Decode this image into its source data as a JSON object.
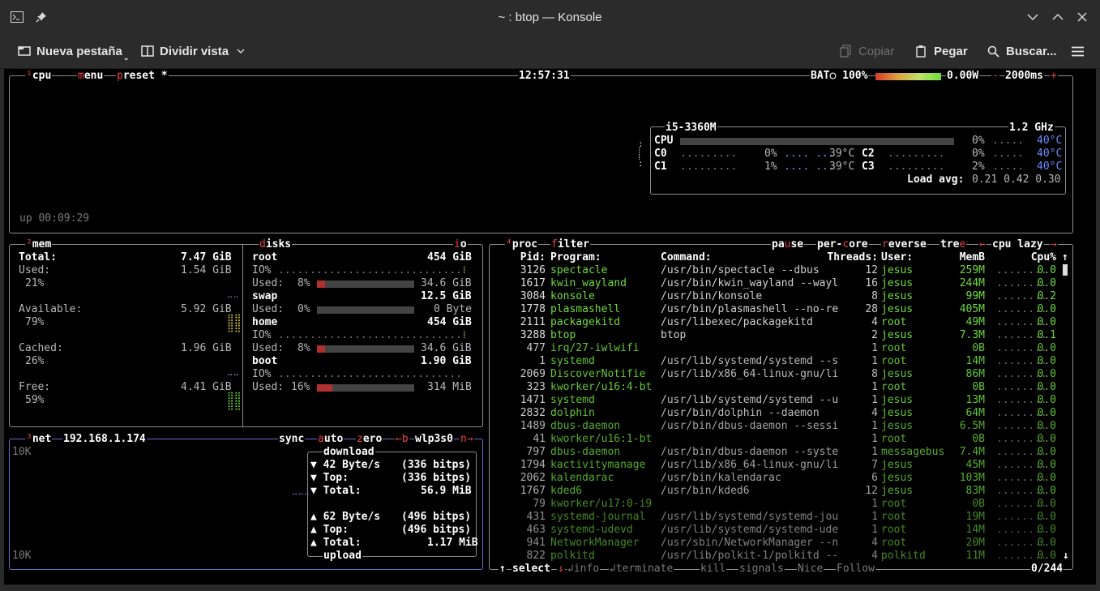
{
  "window": {
    "title": "~ : btop — Konsole",
    "new_tab": "Nueva pestaña",
    "split_view": "Dividir vista",
    "copy": "Copiar",
    "paste": "Pegar",
    "search": "Buscar..."
  },
  "cpu": {
    "label": "cpu",
    "hotkey": "¹",
    "menu": "menu",
    "preset": "preset *",
    "clock": "12:57:31",
    "battery": "BAT○ 100%",
    "power": "0.00W",
    "interval": "2000ms",
    "minus": "-",
    "plus": "+",
    "uptime": "up 00:09:29",
    "model": "i5-3360M",
    "freq": "1.2 GHz",
    "total_label": "CPU",
    "total_pct": "0%",
    "total_temp": "40°C",
    "cores": [
      {
        "name": "C0",
        "pct": "0%",
        "temp": "39°C",
        "value": 0
      },
      {
        "name": "C1",
        "pct": "1%",
        "temp": "39°C",
        "value": 1
      },
      {
        "name": "C2",
        "pct": "0%",
        "temp": "40°C",
        "value": 0
      },
      {
        "name": "C3",
        "pct": "2%",
        "temp": "40°C",
        "value": 2
      }
    ],
    "load_label": "Load avg:",
    "load": "0.21 0.42 0.30"
  },
  "mem": {
    "label": "mem",
    "hotkey": "²",
    "total_label": "Total:",
    "total": "7.47 GiB",
    "used_label": "Used:",
    "used": "1.54 GiB",
    "used_pct": "21%",
    "avail_label": "Available:",
    "avail": "5.92 GiB",
    "avail_pct": "79%",
    "cached_label": "Cached:",
    "cached": "1.96 GiB",
    "cached_pct": "26%",
    "free_label": "Free:",
    "free": "4.41 GiB",
    "free_pct": "59%"
  },
  "disks": {
    "label": "disks",
    "io": "io",
    "items": [
      {
        "name": "root",
        "size": "454 GiB",
        "io": "IO%",
        "used_label": "Used:",
        "pct": "8%",
        "used": "34.6 GiB",
        "value": 8
      },
      {
        "name": "swap",
        "size": "12.5 GiB",
        "io": "",
        "used_label": "Used:",
        "pct": "0%",
        "used": "0 Byte",
        "value": 0
      },
      {
        "name": "home",
        "size": "454 GiB",
        "io": "IO%",
        "used_label": "Used:",
        "pct": "8%",
        "used": "34.6 GiB",
        "value": 8
      },
      {
        "name": "boot",
        "size": "1.90 GiB",
        "io": "IO%",
        "used_label": "Used:",
        "pct": "16%",
        "used": "314 MiB",
        "value": 16
      }
    ]
  },
  "net": {
    "label": "net",
    "hotkey": "³",
    "ip": "192.168.1.174",
    "sync": "sync",
    "auto": "auto",
    "zero": "zero",
    "prev": "←b",
    "iface": "wlp3s0",
    "next": "n→",
    "scale_top": "10K",
    "scale_bottom": "10K",
    "download": "download",
    "upload": "upload",
    "dl_rate": "▼ 42 Byte/s",
    "dl_bits": "(336 bitps)",
    "dl_top_label": "▼ Top:",
    "dl_top": "(336 bitps)",
    "dl_total_label": "▼ Total:",
    "dl_total": "56.9 MiB",
    "ul_rate": "▲ 62 Byte/s",
    "ul_bits": "(496 bitps)",
    "ul_top_label": "▲ Top:",
    "ul_top": "(496 bitps)",
    "ul_total_label": "▲ Total:",
    "ul_total": "1.17 MiB"
  },
  "proc": {
    "label": "proc",
    "hotkey": "⁴",
    "filter": "filter",
    "pause": "pause",
    "per_core": "per-core",
    "reverse": "reverse",
    "tree": "tree",
    "sort_left": "←",
    "sort": "cpu lazy",
    "sort_right": "→",
    "headers": {
      "pid": "Pid:",
      "program": "Program:",
      "command": "Command:",
      "threads": "Threads:",
      "user": "User:",
      "mem": "MemB",
      "cpu": "Cpu%"
    },
    "rows": [
      {
        "pid": "3126",
        "program": "spectacle",
        "command": "/usr/bin/spectacle --dbus",
        "threads": "12",
        "user": "jesus",
        "mem": "259M",
        "cpu": "0.0"
      },
      {
        "pid": "1617",
        "program": "kwin_wayland",
        "command": "/usr/bin/kwin_wayland --wayl",
        "threads": "16",
        "user": "jesus",
        "mem": "244M",
        "cpu": "0.0"
      },
      {
        "pid": "3084",
        "program": "konsole",
        "command": "/usr/bin/konsole",
        "threads": "8",
        "user": "jesus",
        "mem": "99M",
        "cpu": "0.2"
      },
      {
        "pid": "1778",
        "program": "plasmashell",
        "command": "/usr/bin/plasmashell --no-re",
        "threads": "28",
        "user": "jesus",
        "mem": "405M",
        "cpu": "0.0"
      },
      {
        "pid": "2111",
        "program": "packagekitd",
        "command": "/usr/libexec/packagekitd",
        "threads": "4",
        "user": "root",
        "mem": "49M",
        "cpu": "0.0"
      },
      {
        "pid": "3288",
        "program": "btop",
        "command": "btop",
        "threads": "2",
        "user": "jesus",
        "mem": "7.3M",
        "cpu": "0.1"
      },
      {
        "pid": "477",
        "program": "irq/27-iwlwifi",
        "command": "",
        "threads": "1",
        "user": "root",
        "mem": "0B",
        "cpu": "0.0"
      },
      {
        "pid": "1",
        "program": "systemd",
        "command": "/usr/lib/systemd/systemd --s",
        "threads": "1",
        "user": "root",
        "mem": "14M",
        "cpu": "0.0"
      },
      {
        "pid": "2069",
        "program": "DiscoverNotifie",
        "command": "/usr/lib/x86_64-linux-gnu/li",
        "threads": "8",
        "user": "jesus",
        "mem": "86M",
        "cpu": "0.0"
      },
      {
        "pid": "323",
        "program": "kworker/u16:4-bt",
        "command": "",
        "threads": "1",
        "user": "root",
        "mem": "0B",
        "cpu": "0.0"
      },
      {
        "pid": "1471",
        "program": "systemd",
        "command": "/usr/lib/systemd/systemd --u",
        "threads": "1",
        "user": "jesus",
        "mem": "13M",
        "cpu": "0.0"
      },
      {
        "pid": "2832",
        "program": "dolphin",
        "command": "/usr/bin/dolphin --daemon",
        "threads": "4",
        "user": "jesus",
        "mem": "64M",
        "cpu": "0.0"
      },
      {
        "pid": "1489",
        "program": "dbus-daemon",
        "command": "/usr/bin/dbus-daemon --sessi",
        "threads": "1",
        "user": "jesus",
        "mem": "6.5M",
        "cpu": "0.0"
      },
      {
        "pid": "41",
        "program": "kworker/u16:1-bt",
        "command": "",
        "threads": "1",
        "user": "root",
        "mem": "0B",
        "cpu": "0.0"
      },
      {
        "pid": "797",
        "program": "dbus-daemon",
        "command": "/usr/bin/dbus-daemon --syste",
        "threads": "1",
        "user": "messagebus",
        "mem": "7.4M",
        "cpu": "0.0"
      },
      {
        "pid": "1794",
        "program": "kactivitymanage",
        "command": "/usr/lib/x86_64-linux-gnu/li",
        "threads": "7",
        "user": "jesus",
        "mem": "45M",
        "cpu": "0.0"
      },
      {
        "pid": "2062",
        "program": "kalendarac",
        "command": "/usr/bin/kalendarac",
        "threads": "6",
        "user": "jesus",
        "mem": "103M",
        "cpu": "0.0"
      },
      {
        "pid": "1767",
        "program": "kded6",
        "command": "/usr/bin/kded6",
        "threads": "12",
        "user": "jesus",
        "mem": "83M",
        "cpu": "0.0"
      },
      {
        "pid": "79",
        "program": "kworker/u17:0-i9",
        "command": "",
        "threads": "1",
        "user": "root",
        "mem": "0B",
        "cpu": "0.0"
      },
      {
        "pid": "431",
        "program": "systemd-journal",
        "command": "/usr/lib/systemd/systemd-jou",
        "threads": "1",
        "user": "root",
        "mem": "19M",
        "cpu": "0.0"
      },
      {
        "pid": "463",
        "program": "systemd-udevd",
        "command": "/usr/lib/systemd/systemd-ude",
        "threads": "1",
        "user": "root",
        "mem": "14M",
        "cpu": "0.0"
      },
      {
        "pid": "941",
        "program": "NetworkManager",
        "command": "/usr/sbin/NetworkManager --n",
        "threads": "4",
        "user": "root",
        "mem": "20M",
        "cpu": "0.0"
      },
      {
        "pid": "822",
        "program": "polkitd",
        "command": "/usr/lib/polkit-1/polkitd --",
        "threads": "4",
        "user": "polkitd",
        "mem": "11M",
        "cpu": "0.0"
      }
    ],
    "footer": {
      "up": "↑",
      "select": "select",
      "down": "↓",
      "info": "info",
      "terminate": "terminate",
      "kill": "kill",
      "signals": "signals",
      "nice": "Nice",
      "follow": "Follow",
      "count": "0/244"
    }
  },
  "colors": {
    "accent": "#e64444",
    "green": "#6edb3c",
    "blue": "#6b8cff",
    "yellow": "#d9c232"
  }
}
